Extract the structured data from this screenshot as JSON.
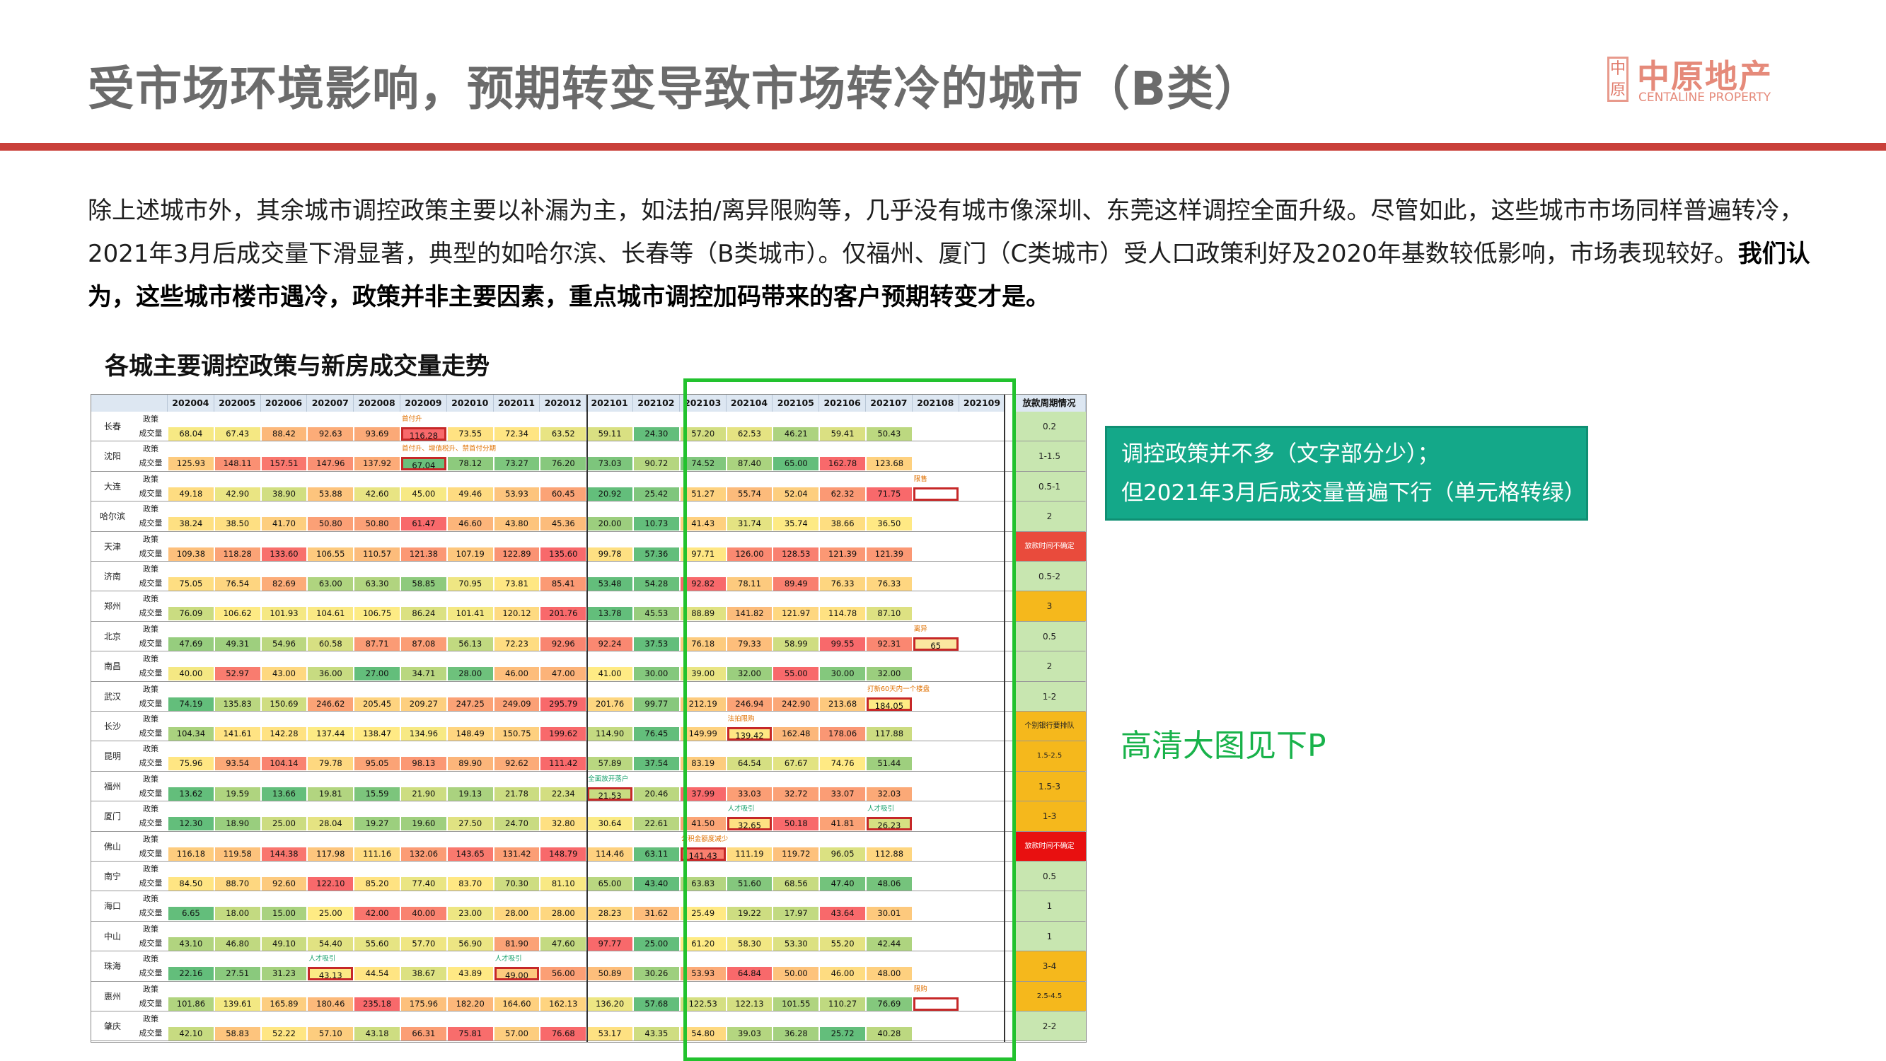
{
  "title": "受市场环境影响，预期转变导致市场转冷的城市（B类）",
  "logo": {
    "seal": "中原",
    "cn": "中原地产",
    "en": "CENTALINE PROPERTY"
  },
  "paragraph": {
    "normal": "除上述城市外，其余城市调控政策主要以补漏为主，如法拍/离异限购等，几乎没有城市像深圳、东莞这样调控全面升级。尽管如此，这些城市市场同样普遍转冷，2021年3月后成交量下滑显著，典型的如哈尔滨、长春等（B类城市）。仅福州、厦门（C类城市）受人口政策利好及2020年基数较低影响，市场表现较好。",
    "bold": "我们认为，这些城市楼市遇冷，政策并非主要因素，重点城市调控加码带来的客户预期转变才是。"
  },
  "subtitle": "各城主要调控政策与新房成交量走势",
  "table": {
    "months": [
      "202004",
      "202005",
      "202006",
      "202007",
      "202008",
      "202009",
      "202010",
      "202011",
      "202012",
      "202101",
      "202102",
      "202103",
      "202104",
      "202105",
      "202106",
      "202107",
      "202108",
      "202109"
    ],
    "last_header": "放款周期情况",
    "policy_label": "政策",
    "volume_label": "成交量",
    "rows": [
      {
        "city": "长春",
        "values": [
          "68.04",
          "67.43",
          "88.42",
          "92.63",
          "93.69",
          "116.28",
          "73.55",
          "72.34",
          "63.52",
          "59.11",
          "24.30",
          "57.20",
          "62.53",
          "46.21",
          "59.41",
          "50.43",
          "",
          ""
        ],
        "cycle": "0.2",
        "notes": [
          {
            "col": 5,
            "text": "首付升"
          }
        ]
      },
      {
        "city": "沈阳",
        "values": [
          "125.93",
          "148.11",
          "157.51",
          "147.96",
          "137.92",
          "67.04",
          "78.12",
          "73.27",
          "76.20",
          "73.03",
          "90.72",
          "74.52",
          "87.40",
          "65.00",
          "162.78",
          "123.68",
          "",
          ""
        ],
        "cycle": "1-1.5",
        "notes": [
          {
            "col": 5,
            "text": "首付升、增值税升、禁首付分期"
          }
        ]
      },
      {
        "city": "大连",
        "values": [
          "49.18",
          "42.90",
          "38.90",
          "53.88",
          "42.60",
          "45.00",
          "49.46",
          "53.93",
          "60.45",
          "20.92",
          "25.42",
          "51.27",
          "55.74",
          "52.04",
          "62.32",
          "71.75",
          "",
          ""
        ],
        "cycle": "0.5-1",
        "notes": [
          {
            "col": 16,
            "text": "限售"
          }
        ]
      },
      {
        "city": "哈尔滨",
        "values": [
          "38.24",
          "38.50",
          "41.70",
          "50.80",
          "50.80",
          "61.47",
          "46.60",
          "43.80",
          "45.36",
          "20.00",
          "10.73",
          "41.43",
          "31.74",
          "35.74",
          "38.66",
          "36.50",
          "",
          ""
        ],
        "cycle": "2",
        "notes": []
      },
      {
        "city": "天津",
        "values": [
          "109.38",
          "118.28",
          "133.60",
          "106.55",
          "110.57",
          "121.38",
          "107.19",
          "122.89",
          "135.60",
          "99.78",
          "57.36",
          "97.71",
          "126.00",
          "128.53",
          "121.39",
          "121.39",
          "",
          ""
        ],
        "cycle": "放款时间不确定",
        "notes": []
      },
      {
        "city": "济南",
        "values": [
          "75.05",
          "76.54",
          "82.69",
          "63.00",
          "63.30",
          "58.85",
          "70.95",
          "73.81",
          "85.41",
          "53.48",
          "54.28",
          "92.82",
          "78.11",
          "89.49",
          "76.33",
          "76.33",
          "",
          ""
        ],
        "cycle": "0.5-2",
        "notes": []
      },
      {
        "city": "郑州",
        "values": [
          "76.09",
          "106.62",
          "101.93",
          "104.61",
          "106.75",
          "86.24",
          "101.41",
          "120.12",
          "201.76",
          "13.78",
          "45.53",
          "88.89",
          "141.82",
          "121.97",
          "114.78",
          "87.10",
          "",
          ""
        ],
        "cycle": "3",
        "notes": []
      },
      {
        "city": "北京",
        "values": [
          "47.69",
          "49.31",
          "54.96",
          "60.58",
          "87.71",
          "87.08",
          "56.13",
          "72.23",
          "92.96",
          "92.24",
          "37.53",
          "76.18",
          "79.33",
          "58.99",
          "99.55",
          "92.31",
          "65",
          ""
        ],
        "cycle": "0.5",
        "notes": [
          {
            "col": 16,
            "text": "离异"
          }
        ]
      },
      {
        "city": "南昌",
        "values": [
          "40.00",
          "52.97",
          "43.00",
          "36.00",
          "27.00",
          "34.71",
          "28.00",
          "46.00",
          "47.00",
          "41.00",
          "30.00",
          "39.00",
          "32.00",
          "55.00",
          "30.00",
          "32.00",
          "",
          ""
        ],
        "cycle": "2",
        "notes": []
      },
      {
        "city": "武汉",
        "values": [
          "74.19",
          "135.83",
          "150.69",
          "246.62",
          "205.45",
          "209.27",
          "247.25",
          "249.09",
          "295.79",
          "201.76",
          "99.77",
          "212.19",
          "246.94",
          "242.90",
          "213.68",
          "184.05",
          "",
          ""
        ],
        "cycle": "1-2",
        "notes": [
          {
            "col": 15,
            "text": "打新60天内一个楼盘"
          }
        ]
      },
      {
        "city": "长沙",
        "values": [
          "104.34",
          "141.61",
          "142.28",
          "137.44",
          "138.47",
          "134.96",
          "148.49",
          "150.75",
          "199.62",
          "114.90",
          "76.45",
          "149.99",
          "139.42",
          "162.48",
          "178.06",
          "117.88",
          "",
          ""
        ],
        "cycle": "个别银行要排队",
        "notes": [
          {
            "col": 12,
            "text": "法拍限购"
          }
        ]
      },
      {
        "city": "昆明",
        "values": [
          "75.96",
          "93.54",
          "104.14",
          "79.78",
          "95.05",
          "98.13",
          "89.90",
          "92.62",
          "111.42",
          "57.89",
          "37.54",
          "83.19",
          "64.54",
          "67.67",
          "74.76",
          "51.44",
          "",
          ""
        ],
        "cycle": "1.5-2.5",
        "notes": []
      },
      {
        "city": "福州",
        "values": [
          "13.62",
          "19.59",
          "13.66",
          "19.81",
          "15.59",
          "21.90",
          "19.13",
          "21.78",
          "22.34",
          "21.53",
          "20.46",
          "37.99",
          "33.03",
          "32.72",
          "33.07",
          "32.03",
          "",
          ""
        ],
        "cycle": "1.5-3",
        "notes": [
          {
            "col": 9,
            "text": "全面放开落户",
            "green": true
          }
        ]
      },
      {
        "city": "厦门",
        "values": [
          "12.30",
          "18.90",
          "25.00",
          "28.04",
          "19.27",
          "19.60",
          "27.50",
          "24.70",
          "32.80",
          "30.64",
          "22.61",
          "41.50",
          "32.65",
          "50.18",
          "41.81",
          "26.23",
          "",
          ""
        ],
        "cycle": "1-3",
        "notes": [
          {
            "col": 12,
            "text": "人才吸引",
            "green": true
          },
          {
            "col": 15,
            "text": "人才吸引",
            "green": true
          }
        ]
      },
      {
        "city": "佛山",
        "values": [
          "116.18",
          "119.58",
          "144.38",
          "117.98",
          "111.16",
          "132.06",
          "143.65",
          "131.42",
          "148.79",
          "114.46",
          "63.11",
          "141.43",
          "111.19",
          "119.72",
          "96.05",
          "112.88",
          "",
          ""
        ],
        "cycle": "放款时间不确定",
        "notes": [
          {
            "col": 11,
            "text": "公积金额度减少"
          }
        ]
      },
      {
        "city": "南宁",
        "values": [
          "84.50",
          "88.70",
          "92.60",
          "122.10",
          "85.20",
          "77.40",
          "83.70",
          "70.30",
          "81.10",
          "65.00",
          "43.40",
          "63.83",
          "51.60",
          "68.56",
          "47.40",
          "48.06",
          "",
          ""
        ],
        "cycle": "0.5",
        "notes": []
      },
      {
        "city": "海口",
        "values": [
          "6.65",
          "18.00",
          "15.00",
          "25.00",
          "42.00",
          "40.00",
          "23.00",
          "28.00",
          "28.00",
          "28.23",
          "31.62",
          "25.49",
          "19.22",
          "17.97",
          "43.64",
          "30.01",
          "",
          ""
        ],
        "cycle": "1",
        "notes": []
      },
      {
        "city": "中山",
        "values": [
          "43.10",
          "46.80",
          "49.10",
          "54.40",
          "55.60",
          "57.70",
          "56.90",
          "81.90",
          "47.60",
          "97.77",
          "25.00",
          "61.20",
          "58.30",
          "53.30",
          "55.20",
          "42.44",
          "",
          ""
        ],
        "cycle": "1",
        "notes": []
      },
      {
        "city": "珠海",
        "values": [
          "22.16",
          "27.51",
          "31.23",
          "43.13",
          "44.54",
          "38.67",
          "43.89",
          "49.00",
          "56.00",
          "50.89",
          "30.26",
          "53.93",
          "64.84",
          "50.00",
          "46.00",
          "48.00",
          "",
          ""
        ],
        "cycle": "3-4",
        "notes": [
          {
            "col": 3,
            "text": "人才吸引",
            "green": true
          },
          {
            "col": 7,
            "text": "人才吸引",
            "green": true
          }
        ]
      },
      {
        "city": "惠州",
        "values": [
          "101.86",
          "139.61",
          "165.89",
          "180.46",
          "235.18",
          "175.96",
          "182.20",
          "164.60",
          "162.13",
          "136.20",
          "57.68",
          "122.53",
          "122.13",
          "101.55",
          "110.27",
          "76.69",
          "",
          ""
        ],
        "cycle": "2.5-4.5",
        "notes": [
          {
            "col": 16,
            "text": "限购"
          }
        ]
      },
      {
        "city": "肇庆",
        "values": [
          "42.10",
          "58.83",
          "52.22",
          "57.10",
          "43.18",
          "66.31",
          "75.81",
          "57.00",
          "76.68",
          "53.17",
          "43.35",
          "54.80",
          "39.03",
          "36.28",
          "25.72",
          "40.28",
          "",
          ""
        ],
        "cycle": "2-2",
        "notes": []
      }
    ]
  },
  "callout": {
    "line1": "调控政策并不多（文字部分少）；",
    "line2": "但2021年3月后成交量普遍下行（单元格转绿）"
  },
  "note": "高清大图见下P",
  "colors": {
    "accent_red": "#c9403a",
    "callout_bg": "#14a889",
    "frame_green": "#22c22e"
  }
}
